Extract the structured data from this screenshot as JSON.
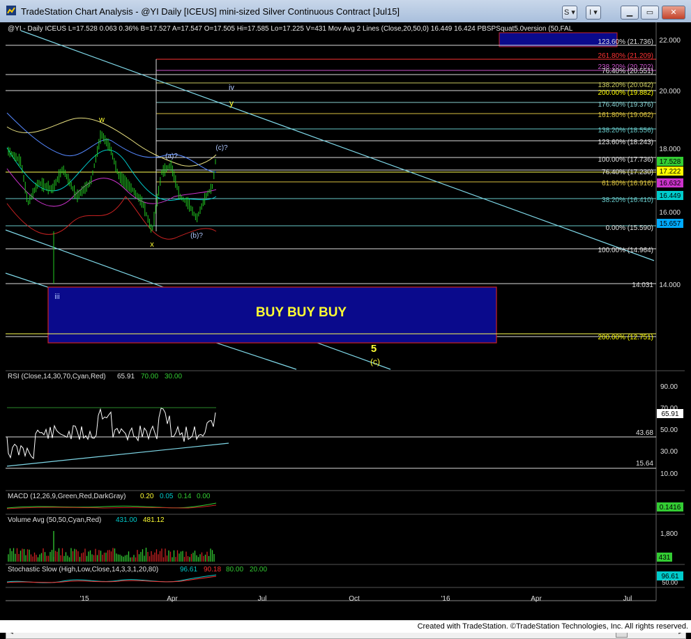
{
  "window": {
    "title": "TradeStation Chart Analysis - @YI Daily [ICEUS] mini-sized Silver Continuous Contract [Jul15]",
    "buttons": [
      "S",
      "I"
    ]
  },
  "price_header": "@YI - Daily  ICEUS  L=17.528  0.063  0.36%  B=17.527  A=17.547  O=17.505  Hi=17.585  Lo=17.225  V=431   Mov Avg 2 Lines (Close,20,50,0)   16.449   16.424   PBSPSquat5.0version (50,FAL",
  "price_axis": [
    "22.000",
    "20.000",
    "18.000",
    "16.000",
    "14.000"
  ],
  "price_tags": [
    {
      "text": "17.528",
      "color": "#33cc33"
    },
    {
      "text": "17.222",
      "color": "#ffff00"
    },
    {
      "text": "16.632",
      "color": "#cc33cc"
    },
    {
      "text": "16.449",
      "color": "#00cccc"
    },
    {
      "text": "15.657",
      "color": "#00aaff"
    }
  ],
  "fib_levels": [
    {
      "text": "123.60% (21.736)",
      "color": "#e0e0e0"
    },
    {
      "text": "261.80% (21.209)",
      "color": "#ff3333"
    },
    {
      "text": "238.20% (20.702)",
      "color": "#cc55cc"
    },
    {
      "text": "76.40% (20.551)",
      "color": "#e0e0e0"
    },
    {
      "text": "138.20% (20.042)",
      "color": "#c8c860"
    },
    {
      "text": "200.00% (19.882)",
      "color": "#ffff00"
    },
    {
      "text": "176.40% (19.376)",
      "color": "#88d0d0"
    },
    {
      "text": "161.80% (19.062)",
      "color": "#d8c040"
    },
    {
      "text": "138.20% (18.556)",
      "color": "#66c8c8"
    },
    {
      "text": "123.60% (18.243)",
      "color": "#e0e0e0"
    },
    {
      "text": "100.00% (17.736)",
      "color": "#e0e0e0"
    },
    {
      "text": "76.40% (17.230)",
      "color": "#e0e0e0"
    },
    {
      "text": "61.80% (16.916)",
      "color": "#d8c040"
    },
    {
      "text": "38.20% (16.410)",
      "color": "#66c8c8"
    },
    {
      "text": "0.00% (15.590)",
      "color": "#e0e0e0"
    },
    {
      "text": "100.00% (14.964)",
      "color": "#e0e0e0"
    },
    {
      "text": "14.031",
      "color": "#e0e0e0"
    },
    {
      "text": "200.00% (12.751)",
      "color": "#ffff00"
    }
  ],
  "wave_labels": {
    "iv": "iv",
    "y": "y",
    "w": "w",
    "x": "x",
    "a": "(a)?",
    "b": "(b)?",
    "c": "(c)?",
    "iii": "iii",
    "five": "5",
    "c_main": "(c)"
  },
  "buy_box_text": "BUY BUY BUY",
  "rsi": {
    "header": "RSI (Close,14,30,70,Cyan,Red)",
    "value": "65.91",
    "upper": "70.00",
    "lower": "30.00",
    "axis": [
      "90.00",
      "70.00",
      "50.00",
      "30.00",
      "10.00"
    ],
    "line_a": "43.68",
    "line_b": "15.64"
  },
  "macd": {
    "header": "MACD (12,26,9,Green,Red,DarkGray)",
    "v1": "0.20",
    "v2": "0.05",
    "v3": "0.14",
    "v4": "0.00",
    "tag": "0.1416"
  },
  "volume": {
    "header": "Volume Avg (50,50,Cyan,Red)",
    "v1": "431.00",
    "v2": "481.12",
    "axis": "1,800",
    "tag": "431"
  },
  "stochastic": {
    "header": "Stochastic Slow (High,Low,Close,14,3,3,1,20,80)",
    "v1": "96.61",
    "v2": "90.18",
    "v3": "80.00",
    "v4": "20.00",
    "tag": "96.61",
    "tag2": "50.00"
  },
  "date_axis": [
    "'15",
    "Apr",
    "Jul",
    "Oct",
    "'16",
    "Apr",
    "Jul"
  ],
  "footer": "Created with TradeStation. ©TradeStation Technologies, Inc. All rights reserved.",
  "colors": {
    "cyan_line": "#7fd8e8",
    "price_bar": "#22cc22",
    "box_fill": "#0a0a8c",
    "box_border": "#cc2222"
  }
}
